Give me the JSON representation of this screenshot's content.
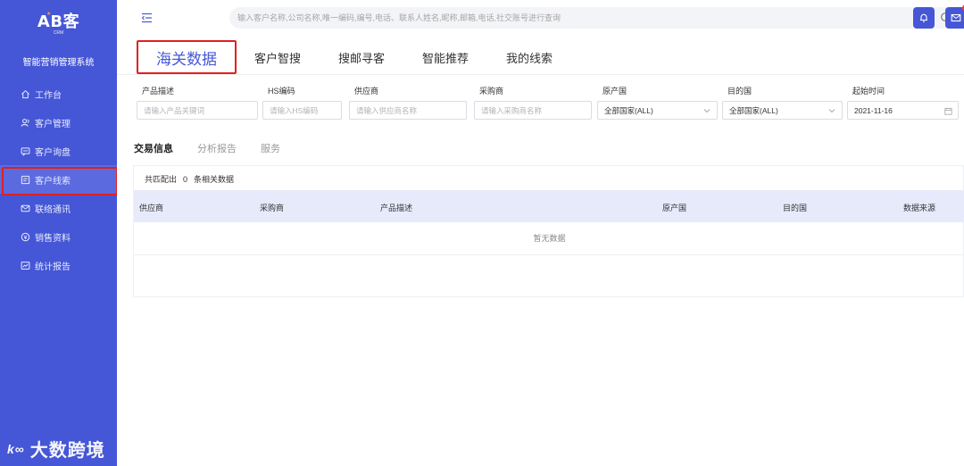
{
  "app": {
    "logo_text": "AB客",
    "logo_sub": "CRM",
    "system_name": "智能营销管理系统"
  },
  "sidebar": {
    "items": [
      {
        "label": "工作台",
        "icon": "home-icon"
      },
      {
        "label": "客户管理",
        "icon": "users-icon"
      },
      {
        "label": "客户询盘",
        "icon": "message-icon"
      },
      {
        "label": "客户线索",
        "icon": "clue-icon",
        "active": true
      },
      {
        "label": "联络通讯",
        "icon": "mail-icon"
      },
      {
        "label": "销售资料",
        "icon": "sales-icon"
      },
      {
        "label": "统计报告",
        "icon": "chart-icon"
      }
    ]
  },
  "watermark": {
    "text": "大数跨境",
    "mark": "k∞"
  },
  "topbar": {
    "search_placeholder": "输入客户名称,公司名称,唯一编码,编号,电话、联系人姓名,昵称,邮箱,电话,社交账号进行查询"
  },
  "tabs": [
    "海关数据",
    "客户智搜",
    "搜邮寻客",
    "智能推荐",
    "我的线索"
  ],
  "filters": {
    "product_desc": {
      "label": "产品描述",
      "placeholder": "请输入产品关键词"
    },
    "hs_code": {
      "label": "HS编码",
      "placeholder": "请输入HS编码"
    },
    "supplier": {
      "label": "供应商",
      "placeholder": "请输入供应商名称"
    },
    "buyer": {
      "label": "采购商",
      "placeholder": "请输入采购商名称"
    },
    "origin": {
      "label": "原产国",
      "value": "全部国家(ALL)"
    },
    "destination": {
      "label": "目的国",
      "value": "全部国家(ALL)"
    },
    "start_time": {
      "label": "起始时间",
      "value": "2021-11-16"
    }
  },
  "subtabs": [
    "交易信息",
    "分析报告",
    "服务"
  ],
  "result": {
    "prefix": "共匹配出",
    "count": "0",
    "suffix": "条相关数据"
  },
  "table": {
    "columns": [
      "供应商",
      "采购商",
      "产品描述",
      "原产国",
      "目的国",
      "数据来源"
    ],
    "empty_text": "暂无数据"
  },
  "colors": {
    "primary": "#4557d6",
    "highlight_box": "#e02020",
    "table_header": "#e7eafb"
  }
}
